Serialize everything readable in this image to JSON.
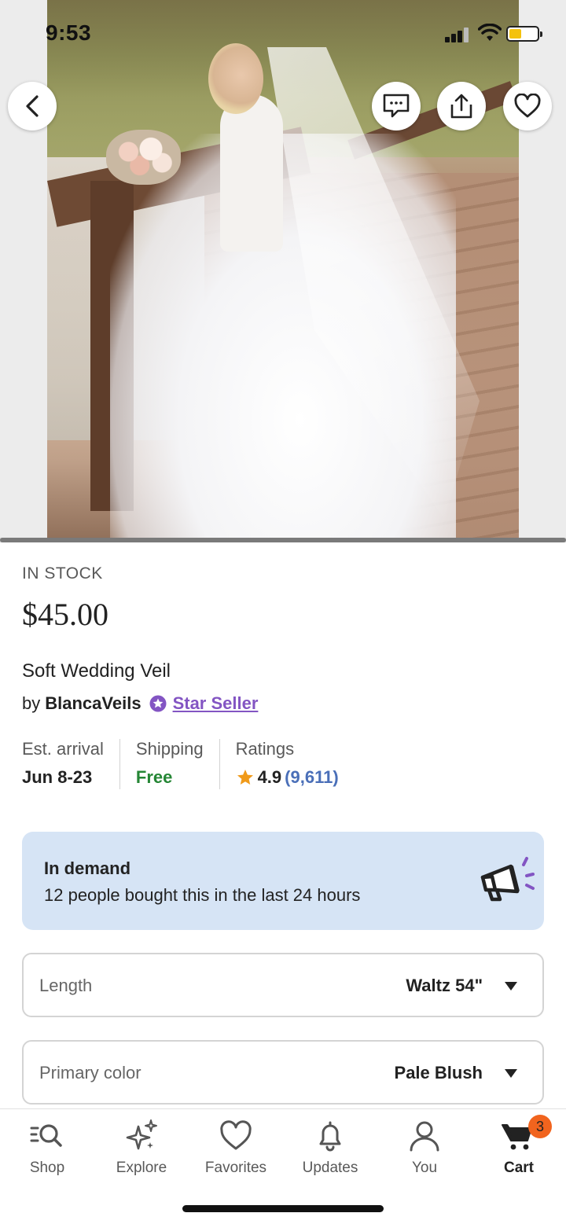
{
  "status_bar": {
    "time": "9:53",
    "battery_level": 0.45
  },
  "gallery": {
    "current_image": 1,
    "progress_fraction": 1.0
  },
  "header_actions": {
    "back_icon": "chevron-left-icon",
    "message_icon": "message-icon",
    "share_icon": "share-icon",
    "favorite_icon": "heart-icon"
  },
  "product": {
    "stock_status": "IN STOCK",
    "price": "$45.00",
    "title": "Soft Wedding Veil",
    "by_label": "by",
    "shop_name": "BlancaVeils",
    "seller_badge": "Star Seller",
    "accent_color": "#8355c3"
  },
  "facts": {
    "arrival_label": "Est. arrival",
    "arrival_value": "Jun 8-23",
    "shipping_label": "Shipping",
    "shipping_value": "Free",
    "ratings_label": "Ratings",
    "rating_value": "4.9",
    "rating_count": "(9,611)"
  },
  "demand_banner": {
    "heading": "In demand",
    "text": "12 people bought this in the last 24 hours",
    "icon": "megaphone-icon"
  },
  "selectors": {
    "length_label": "Length",
    "length_value": "Waltz 54\"",
    "color_label": "Primary color",
    "color_value": "Pale Blush"
  },
  "bottom_nav": {
    "shop": "Shop",
    "explore": "Explore",
    "favorites": "Favorites",
    "updates": "Updates",
    "you": "You",
    "cart": "Cart",
    "cart_count": "3",
    "active": "Cart"
  }
}
